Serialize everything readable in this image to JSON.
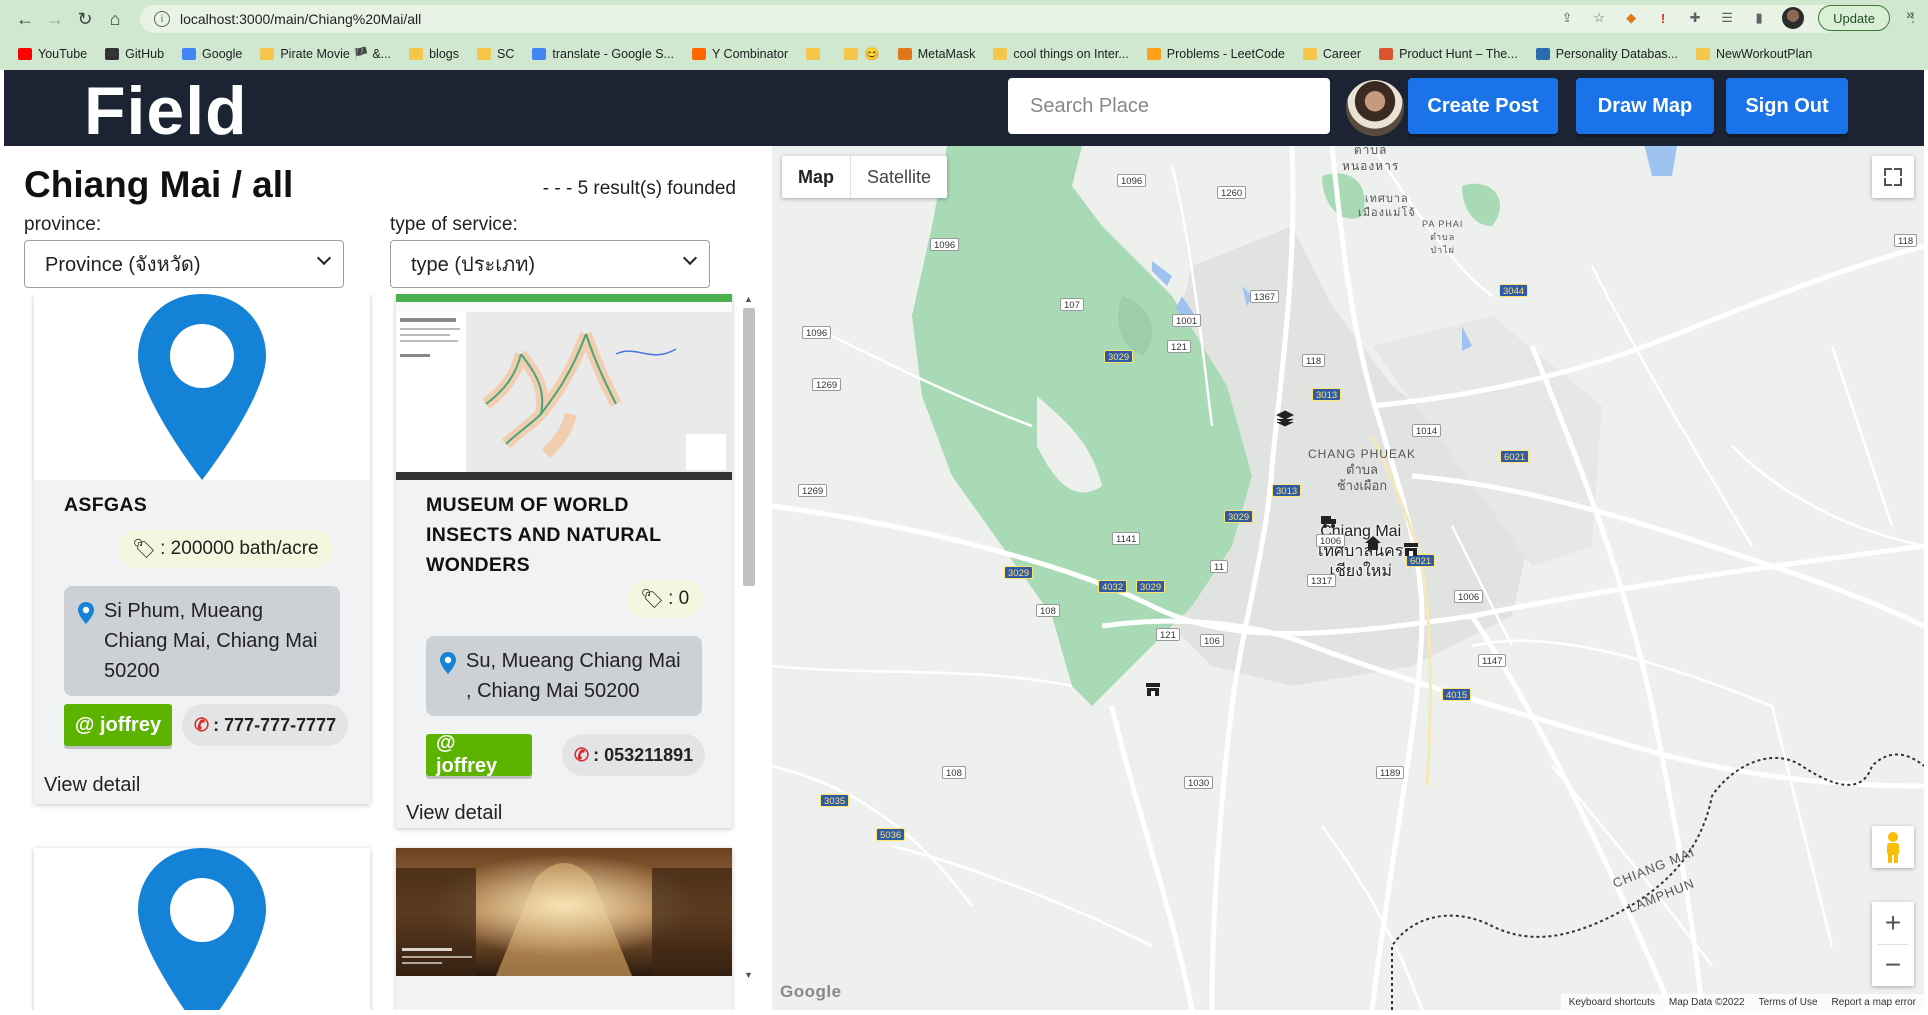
{
  "browser": {
    "url": "localhost:3000/main/Chiang%20Mai/all",
    "update_label": "Update",
    "bookmarks": [
      {
        "label": "YouTube",
        "icon": "youtube-icon",
        "color": "#ff0000"
      },
      {
        "label": "GitHub",
        "icon": "github-icon",
        "color": "#333333"
      },
      {
        "label": "Google",
        "icon": "google-icon",
        "color": "#4285f4"
      },
      {
        "label": "Pirate Movie 🏴 &...",
        "icon": "folder-icon",
        "color": "#f6c64b"
      },
      {
        "label": "blogs",
        "icon": "folder-icon",
        "color": "#f6c64b"
      },
      {
        "label": "SC",
        "icon": "folder-icon",
        "color": "#f6c64b"
      },
      {
        "label": "translate - Google S...",
        "icon": "google-icon",
        "color": "#4285f4"
      },
      {
        "label": "Y Combinator",
        "icon": "ycombinator-icon",
        "color": "#ff6600"
      },
      {
        "label": "",
        "icon": "folder-icon",
        "color": "#f6c64b"
      },
      {
        "label": "😊",
        "icon": "emoji-icon",
        "color": "#f6c64b"
      },
      {
        "label": "MetaMask",
        "icon": "metamask-icon",
        "color": "#e2761b"
      },
      {
        "label": "cool things on Inter...",
        "icon": "folder-icon",
        "color": "#f6c64b"
      },
      {
        "label": "Problems - LeetCode",
        "icon": "leetcode-icon",
        "color": "#ffa116"
      },
      {
        "label": "Career",
        "icon": "folder-icon",
        "color": "#f6c64b"
      },
      {
        "label": "Product Hunt – The...",
        "icon": "producthunt-icon",
        "color": "#da552f"
      },
      {
        "label": "Personality Databas...",
        "icon": "personality-icon",
        "color": "#2b6cb0"
      },
      {
        "label": "NewWorkoutPlan",
        "icon": "folder-icon",
        "color": "#f6c64b"
      }
    ],
    "more_bookmarks": "»"
  },
  "header": {
    "logo": "Field",
    "search_placeholder": "Search Place",
    "buttons": {
      "create_post": "Create Post",
      "draw_map": "Draw Map",
      "sign_out": "Sign Out"
    }
  },
  "list": {
    "title": "Chiang Mai / all",
    "results": "- - - 5 result(s) founded",
    "province_label": "province:",
    "province_value": "Province (จังหวัด)",
    "service_label": "type of service:",
    "service_value": "type (ประเภท)",
    "view_detail": "View detail",
    "cards": [
      {
        "title": "ASFGAS",
        "price": ": 200000 bath/acre",
        "address": "Si Phum, Mueang Chiang Mai, Chiang Mai 50200",
        "user": "@ joffrey",
        "phone": ": 777-777-7777"
      },
      {
        "title": "MUSEUM OF WORLD INSECTS AND NATURAL WONDERS",
        "price": ": 0",
        "address": "Su, Mueang Chiang Mai , Chiang Mai 50200",
        "user": "@ joffrey",
        "phone": ": 053211891"
      }
    ]
  },
  "map": {
    "type_map": "Map",
    "type_satellite": "Satellite",
    "google": "Google",
    "attribution": [
      "Keyboard shortcuts",
      "Map Data ©2022",
      "Terms of Use",
      "Report a map error"
    ],
    "labels": {
      "chang_phueak": "CHANG PHUEAK",
      "chang_phueak_th1": "ตำบล",
      "chang_phueak_th2": "ช้างเผือก",
      "city_en": "Chiang Mai",
      "city_th1": "เทศบาลนคร",
      "city_th2": "เชียงใหม่",
      "top_th1": "ตาบล",
      "top_th2": "หนองหาร",
      "mae_jo1": "เทศบาล",
      "mae_jo2": "เมืองแม่โจ้",
      "pa_phai1": "PA PHAI",
      "pa_phai2": "ตำบล",
      "pa_phai3": "ป่าไผ่",
      "border1": "CHIANG MAI",
      "border2": "LAMPHUN"
    },
    "colors": {
      "park": "#a8dab5",
      "land": "#eef0ee",
      "urban": "#e1e3e1",
      "road": "#ffffff",
      "water": "#9fc3f0"
    }
  }
}
